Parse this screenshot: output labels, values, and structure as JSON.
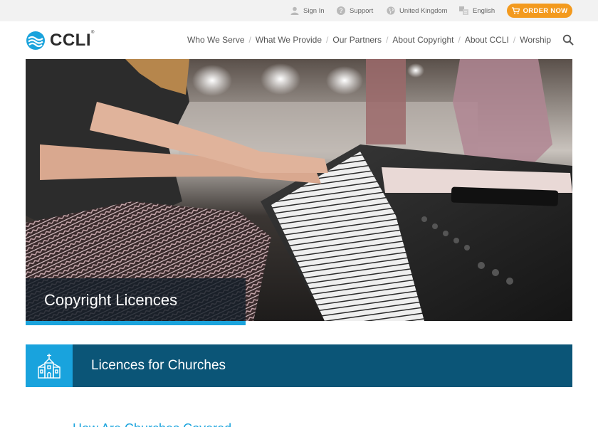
{
  "utility": {
    "sign_in": "Sign In",
    "support": "Support",
    "region": "United Kingdom",
    "language": "English",
    "order_now": "ORDER NOW"
  },
  "brand": {
    "name": "CCLI",
    "trademark": "®",
    "accent": "#19a3dd",
    "dark_accent": "#0b5577",
    "order_color": "#f39a1e"
  },
  "nav": {
    "items": [
      {
        "label": "Who We Serve"
      },
      {
        "label": "What We Provide"
      },
      {
        "label": "Our Partners"
      },
      {
        "label": "About Copyright"
      },
      {
        "label": "About CCLI"
      },
      {
        "label": "Worship"
      }
    ],
    "separator": "/"
  },
  "hero": {
    "caption": "Copyright Licences",
    "image": "person playing keyboard piano"
  },
  "section": {
    "icon": "church-icon",
    "title": "Licences for Churches"
  },
  "below_fold": {
    "heading": "How Are Churches Covered"
  }
}
